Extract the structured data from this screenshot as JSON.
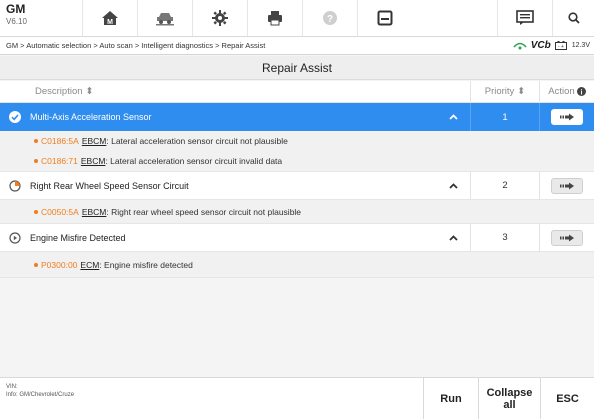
{
  "toolbar": {
    "brand": "GM",
    "version": "V6.10",
    "icons": [
      "home-icon",
      "vehicle-lift-icon",
      "gear-icon",
      "printer-icon",
      "help-icon",
      "save-icon",
      "chat-icon",
      "search-icon"
    ]
  },
  "breadcrumb": "GM > Automatic selection > Auto scan > Intelligent diagnostics > Repair Assist",
  "vci": {
    "label": "VCb",
    "voltage": "12.3V"
  },
  "page_title": "Repair Assist",
  "table": {
    "headers": {
      "description": "Description",
      "priority": "Priority",
      "action": "Action"
    },
    "rows": [
      {
        "name": "Multi-Axis Acceleration Sensor",
        "priority": "1",
        "selected": true,
        "details": [
          {
            "code": "C0186:5A",
            "module": "EBCM",
            "text": ": Lateral acceleration sensor circuit not plausible"
          },
          {
            "code": "C0186:71",
            "module": "EBCM",
            "text": ": Lateral acceleration sensor circuit invalid data"
          }
        ]
      },
      {
        "name": "Right Rear Wheel Speed Sensor Circuit",
        "priority": "2",
        "selected": false,
        "details": [
          {
            "code": "C0050:5A",
            "module": "EBCM",
            "text": ": Right rear wheel speed sensor circuit not plausible"
          }
        ]
      },
      {
        "name": "Engine Misfire Detected",
        "priority": "3",
        "selected": false,
        "details": [
          {
            "code": "P0300:00",
            "module": "ECM",
            "text": ": Engine misfire detected"
          }
        ]
      }
    ]
  },
  "footer": {
    "vin_label": "VIN:",
    "info": "Info: GM/Chevrolet/Cruze",
    "run_label": "Run",
    "collapse_label": "Collapse all",
    "esc_label": "ESC"
  },
  "colors": {
    "accent": "#2f8df0",
    "code": "#f07d1e"
  }
}
